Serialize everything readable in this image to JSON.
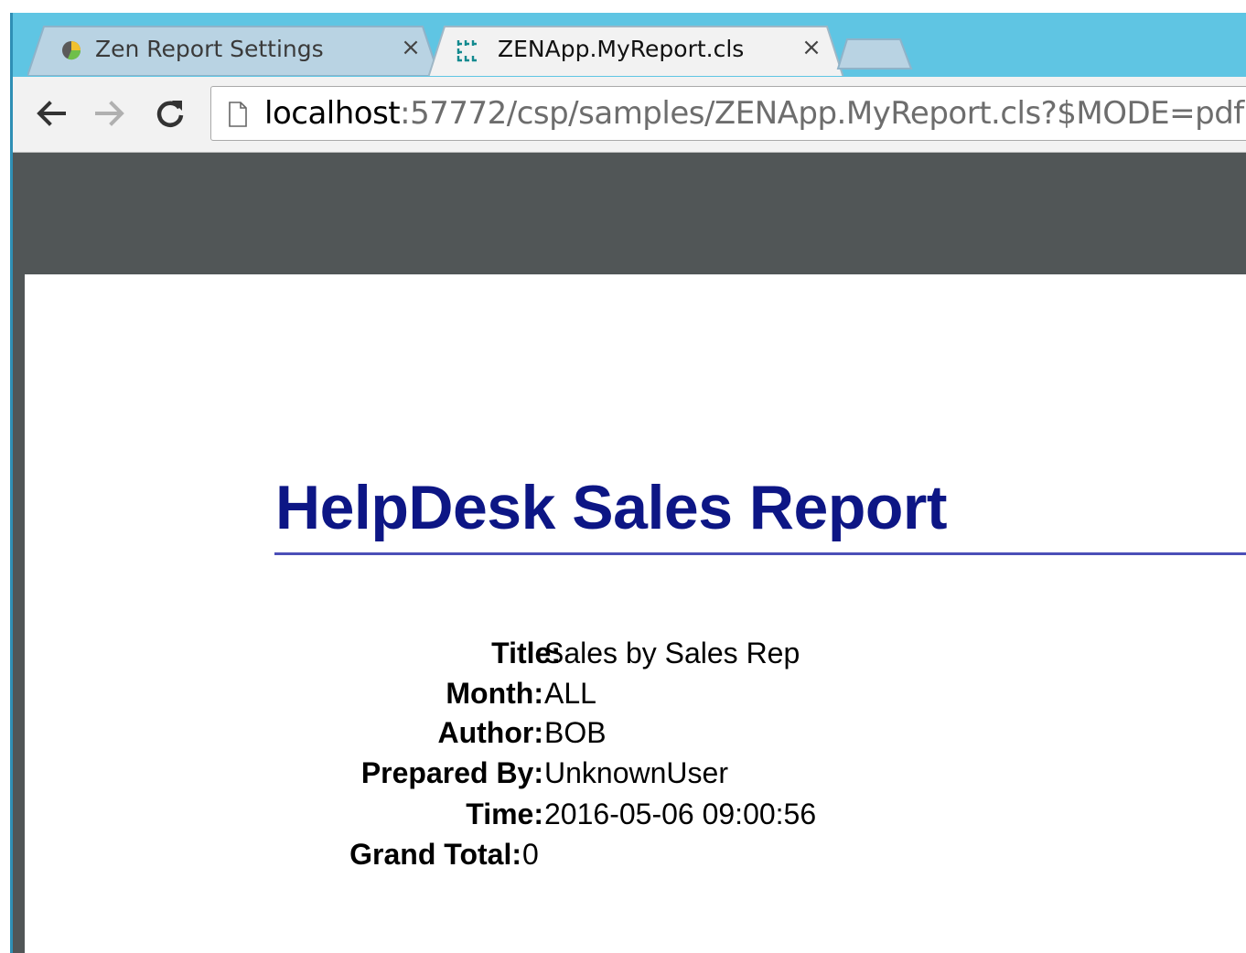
{
  "browser": {
    "tabs": [
      {
        "label": "Zen Report Settings",
        "icon": "pie-chart-icon",
        "active": false
      },
      {
        "label": "ZENApp.MyReport.cls",
        "icon": "zen-grid-icon",
        "active": true
      }
    ],
    "close_glyph": "×",
    "address": {
      "host": "localhost",
      "rest": ":57772/csp/samples/ZENApp.MyReport.cls?$MODE=pdf"
    }
  },
  "report": {
    "title": "HelpDesk Sales Report",
    "fields": [
      {
        "label": "Title:",
        "value": "Sales by Sales Rep"
      },
      {
        "label": "Month:",
        "value": "ALL"
      },
      {
        "label": "Author:",
        "value": "BOB"
      },
      {
        "label": "Prepared By:",
        "value": "UnknownUser"
      },
      {
        "label": "Time:",
        "value": "2016-05-06 09:00:56"
      },
      {
        "label": "Grand Total:",
        "value": "0"
      }
    ]
  },
  "colors": {
    "tabstrip": "#5fc5e3",
    "viewer": "#515657",
    "title": "#0d1685",
    "rule": "#4b4fb8"
  }
}
